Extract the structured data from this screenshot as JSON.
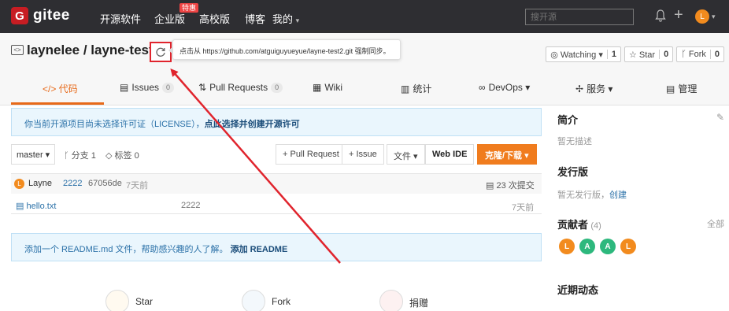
{
  "nav": {
    "logo_mark": "G",
    "logo_text": "gitee",
    "items": [
      "开源软件",
      "企业版",
      "高校版",
      "博客",
      "我的"
    ],
    "hot_badge": "特惠",
    "my_caret": "▾",
    "search_placeholder": "搜开源",
    "plus": "+",
    "avatar_letter": "L",
    "avatar_caret": "▾"
  },
  "repo": {
    "icon_text": "<>",
    "title": "laynelee / layne-test2",
    "tooltip": "点击从 https://github.com/atguiguyueyue/layne-test2.git 强制同步。",
    "watch_label": "◎ Watching ▾",
    "watch_count": "1",
    "star_label": "☆ Star",
    "star_count": "0",
    "fork_label": "ᚴ Fork",
    "fork_count": "0"
  },
  "tabs": {
    "code": "</> 代码",
    "issues": "Issues",
    "issues_count": "0",
    "pull_requests": "Pull Requests",
    "pull_requests_count": "0",
    "wiki": "Wiki",
    "stats": "统计",
    "devops": "DevOps ▾",
    "services": "服务 ▾",
    "manage": "管理"
  },
  "license_notice": {
    "text": "你当前开源项目尚未选择许可证（LICENSE），",
    "link": "点此选择并创建开源许可"
  },
  "toolbar": {
    "branch": "master ▾",
    "branches": "分支 1",
    "tags": "标签 0",
    "pull_request": "+ Pull Request",
    "issue": "+ Issue",
    "files": "文件 ▾",
    "web_ide": "Web IDE",
    "clone": "克隆/下载 ▾"
  },
  "commit": {
    "avatar_letter": "L",
    "author": "Layne",
    "message": "2222",
    "hash": "67056de",
    "time": "7天前",
    "commits": "23 次提交"
  },
  "files": [
    {
      "name": "hello.txt",
      "message": "2222",
      "time": "7天前"
    }
  ],
  "readme_notice": {
    "text": "添加一个 README.md 文件，帮助感兴趣的人了解。",
    "link": "添加 README"
  },
  "stats": {
    "star": "Star",
    "fork": "Fork",
    "donate": "捐赠"
  },
  "sidebar": {
    "intro_title": "简介",
    "intro_text": "暂无描述",
    "release_title": "发行版",
    "release_text": "暂无发行版，",
    "release_link": "创建",
    "contributors_title": "贡献者",
    "contributors_count": "(4)",
    "contributors_all": "全部",
    "contributors": [
      "L",
      "A",
      "A",
      "L"
    ],
    "activity_title": "近期动态"
  },
  "colors": {
    "accent": "#e76a1a",
    "highlight": "#e0242d",
    "contributor_orange": "#f28b1e",
    "contributor_green": "#2db87d"
  }
}
